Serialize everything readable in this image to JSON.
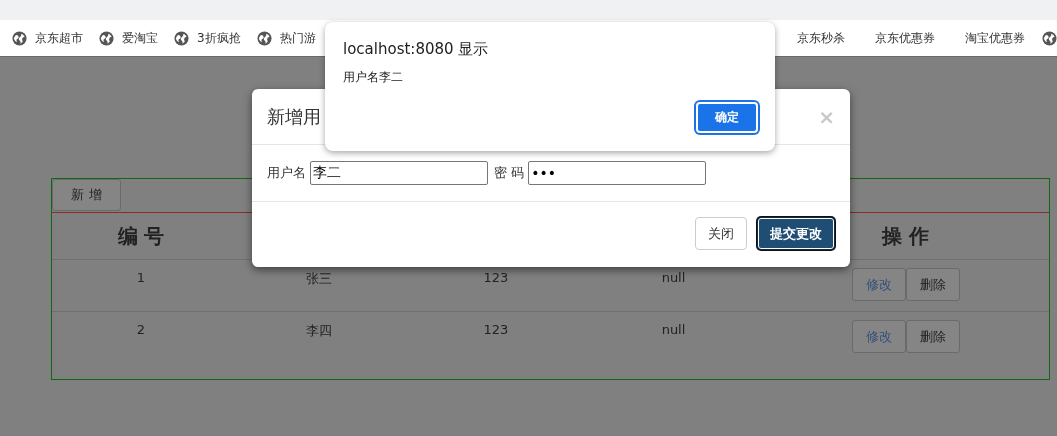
{
  "bookmarks_left": [
    {
      "label": "京东超市",
      "kind": "globe"
    },
    {
      "label": "爱淘宝",
      "kind": "globe"
    },
    {
      "label": "3折疯抢",
      "kind": "globe"
    },
    {
      "label": "热门游",
      "kind": "globe"
    }
  ],
  "bookmarks_right": [
    {
      "label": "京东秒杀",
      "kind": "plain"
    },
    {
      "label": "京东优惠券",
      "kind": "plain"
    },
    {
      "label": "淘宝优惠券",
      "kind": "plain"
    },
    {
      "kind": "icon"
    }
  ],
  "table": {
    "add_button": "新 增",
    "columns": [
      {
        "label": "编 号"
      },
      {
        "label": "操 作"
      }
    ],
    "rows": [
      {
        "cells": [
          "1",
          "张三",
          "123",
          "null"
        ],
        "actions": [
          {
            "label": "修改",
            "kind": "link"
          },
          {
            "label": "删除",
            "kind": "default"
          }
        ]
      },
      {
        "cells": [
          "2",
          "李四",
          "123",
          "null"
        ],
        "actions": [
          {
            "label": "修改",
            "kind": "link"
          },
          {
            "label": "删除",
            "kind": "default"
          }
        ]
      }
    ]
  },
  "modal": {
    "title": "新增用",
    "close": "×",
    "fields": [
      {
        "label": "用户名",
        "value": "李二"
      },
      {
        "label": "密 码",
        "value": "•••"
      }
    ],
    "buttons": [
      {
        "label": "关闭",
        "kind": "default"
      },
      {
        "label": "提交更改",
        "kind": "primary"
      }
    ]
  },
  "alert": {
    "title": "localhost:8080 显示",
    "message": "用户名李二",
    "button": "确定"
  }
}
